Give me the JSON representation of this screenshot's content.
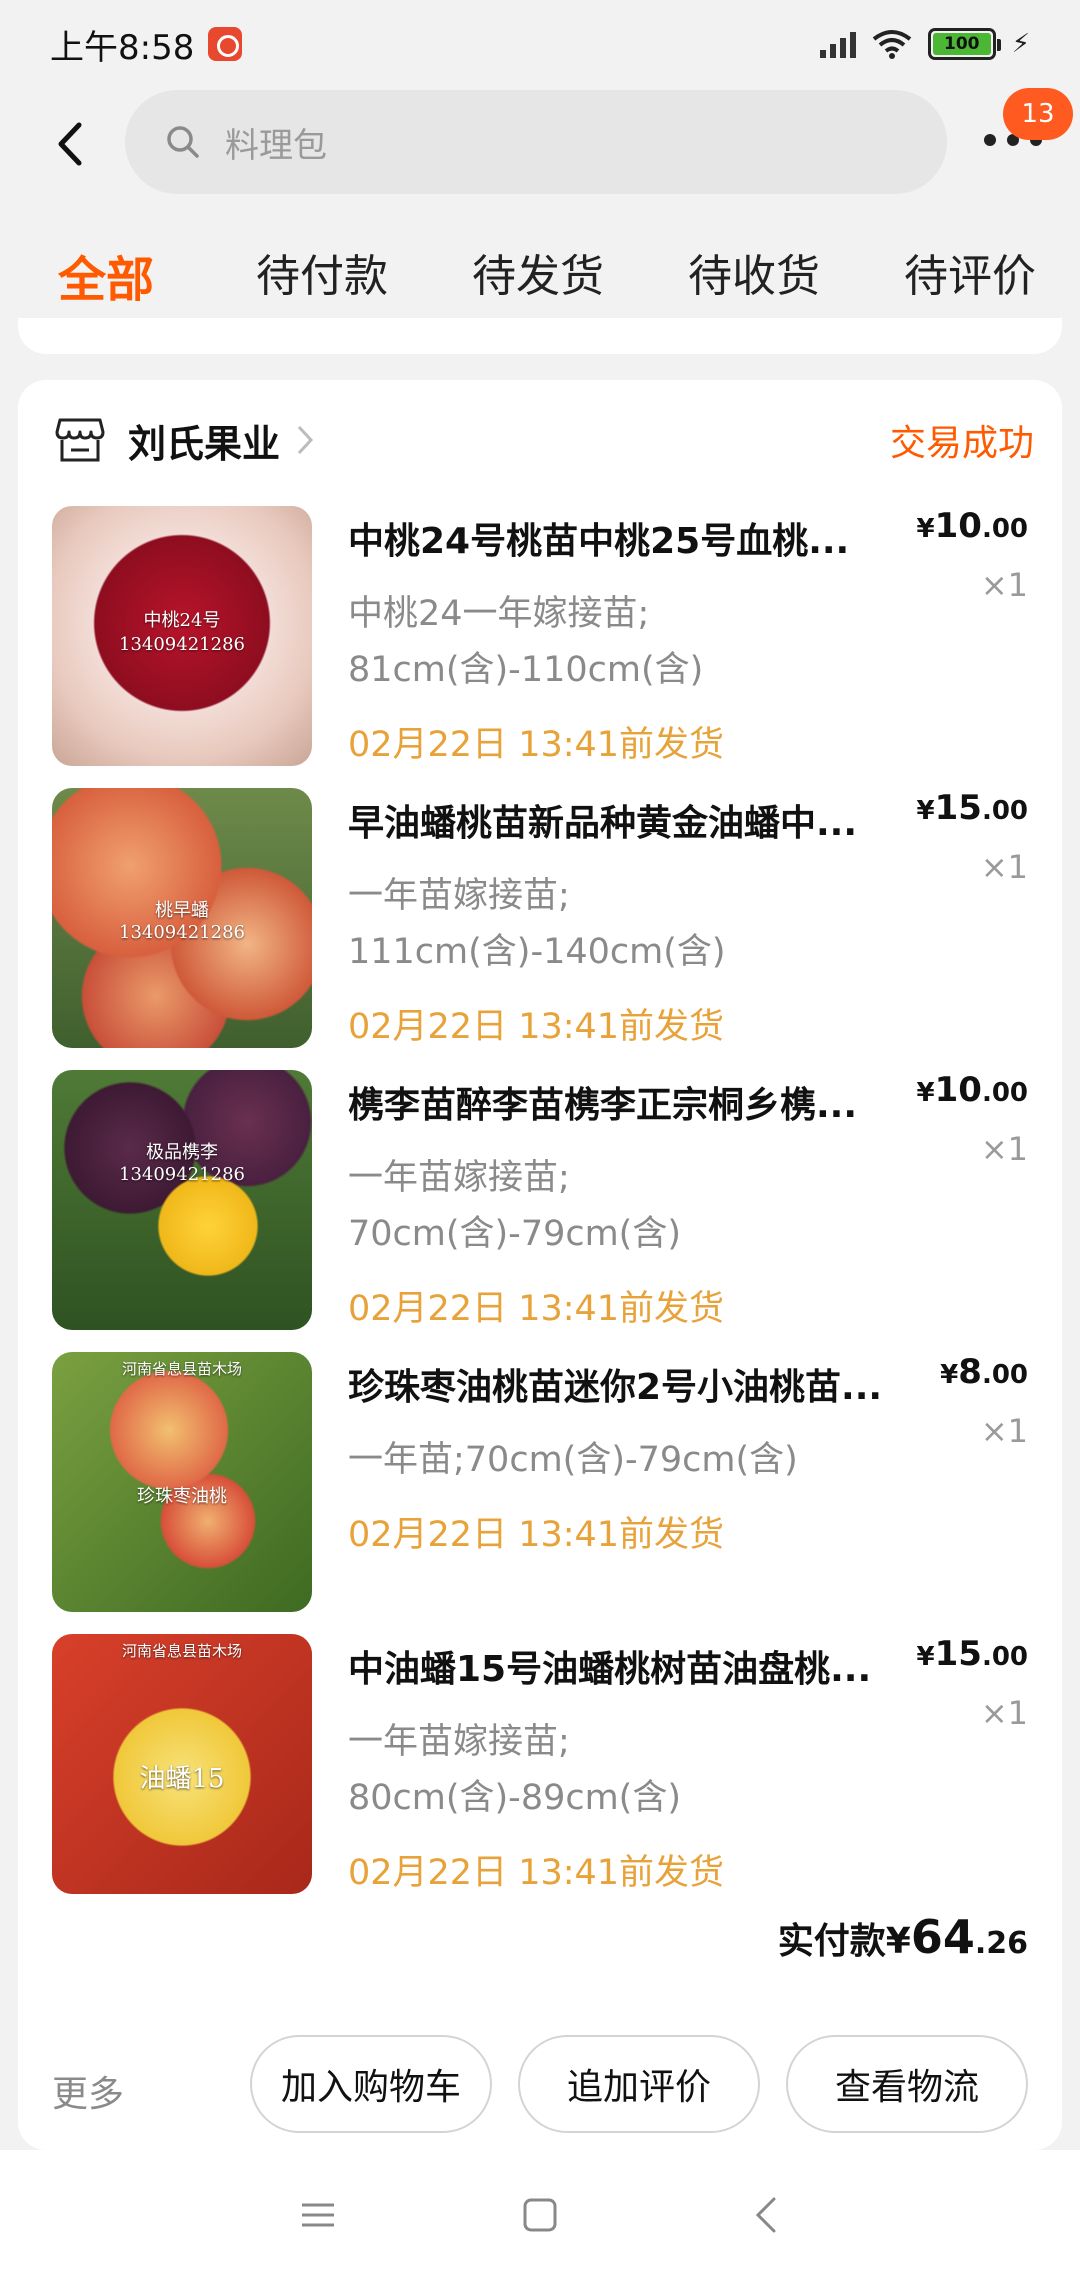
{
  "status_bar": {
    "time": "上午8:58",
    "battery": "100"
  },
  "search": {
    "placeholder": "料理包"
  },
  "header": {
    "badge_count": "13"
  },
  "tabs": [
    {
      "label": "全部"
    },
    {
      "label": "待付款"
    },
    {
      "label": "待发货"
    },
    {
      "label": "待收货"
    },
    {
      "label": "待评价"
    }
  ],
  "order": {
    "shop_name": "刘氏果业",
    "status": "交易成功",
    "items": [
      {
        "title": "中桃24号桃苗中桃25号血桃...",
        "spec_line1": "中桃24一年嫁接苗;",
        "spec_line2": "81cm(含)-110cm(含)",
        "ship": "02月22日 13:41前发货",
        "price_int": "10",
        "price_dec": ".00",
        "qty": "×1",
        "thumb_label1": "中桃24号",
        "thumb_label2": "13409421286"
      },
      {
        "title": "早油蟠桃苗新品种黄金油蟠中...",
        "spec_line1": "一年苗嫁接苗;",
        "spec_line2": "111cm(含)-140cm(含)",
        "ship": "02月22日 13:41前发货",
        "price_int": "15",
        "price_dec": ".00",
        "qty": "×1",
        "thumb_label1": "桃早蟠",
        "thumb_label2": "13409421286"
      },
      {
        "title": "槜李苗醉李苗槜李正宗桐乡槜...",
        "spec_line1": "一年苗嫁接苗;",
        "spec_line2": "70cm(含)-79cm(含)",
        "ship": "02月22日 13:41前发货",
        "price_int": "10",
        "price_dec": ".00",
        "qty": "×1",
        "thumb_label1": "极品槜李",
        "thumb_label2": "13409421286"
      },
      {
        "title": "珍珠枣油桃苗迷你2号小油桃苗...",
        "spec_line1": "一年苗;70cm(含)-79cm(含)",
        "spec_line2": "",
        "ship": "02月22日 13:41前发货",
        "price_int": "8",
        "price_dec": ".00",
        "qty": "×1",
        "thumb_label1": "河南省息县苗木场",
        "thumb_label2": "珍珠枣油桃"
      },
      {
        "title": "中油蟠15号油蟠桃树苗油盘桃...",
        "spec_line1": "一年苗嫁接苗;",
        "spec_line2": "80cm(含)-89cm(含)",
        "ship": "02月22日 13:41前发货",
        "price_int": "15",
        "price_dec": ".00",
        "qty": "×1",
        "thumb_label1": "河南省息县苗木场",
        "thumb_label2": "油蟠15"
      }
    ],
    "total_label": "实付款¥",
    "total_int": "64",
    "total_dec": ".26",
    "more_label": "更多",
    "actions": [
      "加入购物车",
      "追加评价",
      "查看物流"
    ]
  },
  "colors": {
    "accent": "#ff5a00",
    "ship": "#e8a23a",
    "badge": "#ff5a1f"
  }
}
